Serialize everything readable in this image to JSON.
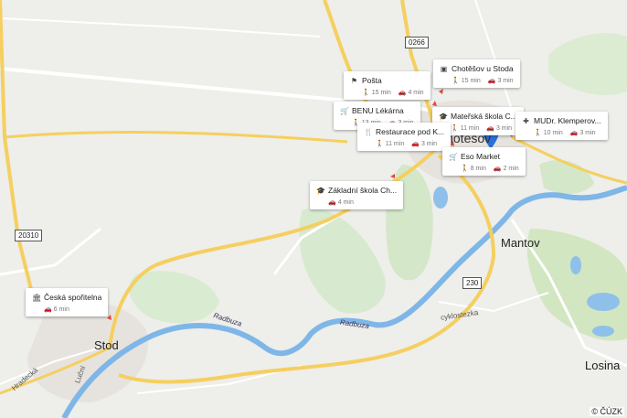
{
  "places": {
    "stod": "Stod",
    "mantov": "Mantov",
    "losina": "Losina",
    "chotesov": "Chotěšov"
  },
  "rivers": {
    "radbuza1": "Radbuza",
    "radbuza2": "Radbuza"
  },
  "streets": {
    "hradecka": "Hradecká",
    "lucni": "Luční",
    "cyklostezka": "cyklostezka"
  },
  "road_shields": {
    "r0266": "0266",
    "r20310": "20310",
    "r230": "230"
  },
  "pois": [
    {
      "name": "Pošta",
      "icon": "post-icon",
      "glyph": "⚑",
      "walk": "15 min",
      "car": "4 min"
    },
    {
      "name": "Chotěšov u Stoda",
      "icon": "bus-icon",
      "glyph": "▣",
      "walk": "15 min",
      "car": "3 min"
    },
    {
      "name": "BENU Lékárna",
      "icon": "cart-icon",
      "glyph": "🛒",
      "walk": "13 min",
      "car": "3 min"
    },
    {
      "name": "Mateřská škola C...",
      "icon": "school-icon",
      "glyph": "🎓",
      "walk": "11 min",
      "car": "3 min"
    },
    {
      "name": "MUDr. Klemperov...",
      "icon": "medical-icon",
      "glyph": "✚",
      "walk": "10 min",
      "car": "3 min"
    },
    {
      "name": "Restaurace pod K...",
      "icon": "restaurant-icon",
      "glyph": "🍴",
      "walk": "11 min",
      "car": "3 min"
    },
    {
      "name": "Eso Market",
      "icon": "cart-icon",
      "glyph": "🛒",
      "walk": "8 min",
      "car": "2 min"
    },
    {
      "name": "Základní škola Ch...",
      "icon": "school-icon",
      "glyph": "🎓",
      "walk": "",
      "car": "4 min"
    },
    {
      "name": "Česká spořitelna",
      "icon": "bank-icon",
      "glyph": "🏛",
      "walk": "",
      "car": "6 min"
    }
  ],
  "colors": {
    "road_major": "#f5cf5f",
    "water": "#7fb6e8",
    "forest": "#cfe5b8",
    "pin": "#2a6fdb"
  },
  "copyright": "© ČÚZK"
}
